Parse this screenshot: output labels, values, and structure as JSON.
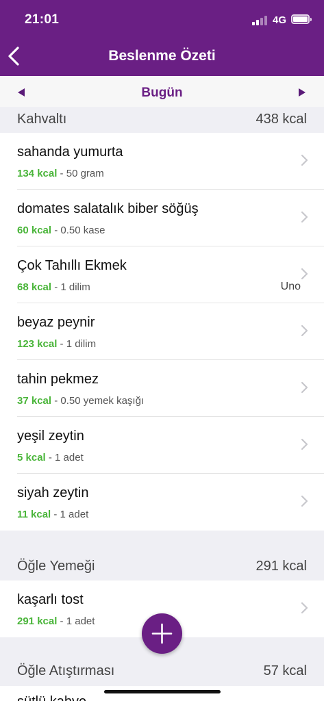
{
  "status": {
    "time": "21:01",
    "network": "4G"
  },
  "nav": {
    "title": "Beslenme Özeti"
  },
  "date": {
    "label": "Bugün"
  },
  "sections": [
    {
      "name": "Kahvaltı",
      "kcal": "438 kcal",
      "items": [
        {
          "name": "sahanda yumurta",
          "kcal": "134 kcal",
          "amount": " - 50 gram"
        },
        {
          "name": "domates salatalık biber söğüş",
          "kcal": "60 kcal",
          "amount": " - 0.50 kase"
        },
        {
          "name": "Çok Tahıllı Ekmek",
          "kcal": "68 kcal",
          "amount": " - 1 dilim",
          "brand": "Uno"
        },
        {
          "name": "beyaz peynir",
          "kcal": "123 kcal",
          "amount": " - 1 dilim"
        },
        {
          "name": "tahin pekmez",
          "kcal": "37 kcal",
          "amount": " - 0.50 yemek kaşığı"
        },
        {
          "name": "yeşil zeytin",
          "kcal": "5 kcal",
          "amount": " - 1 adet"
        },
        {
          "name": "siyah zeytin",
          "kcal": "11 kcal",
          "amount": " - 1 adet"
        }
      ]
    },
    {
      "name": "Öğle Yemeği",
      "kcal": "291 kcal",
      "items": [
        {
          "name": "kaşarlı tost",
          "kcal": "291 kcal",
          "amount": " - 1 adet"
        }
      ]
    },
    {
      "name": "Öğle Atıştırması",
      "kcal": "57 kcal",
      "items": [
        {
          "name": "sütlü kahve"
        }
      ]
    }
  ],
  "colors": {
    "brand": "#6a1f84",
    "calorie": "#4ab53a"
  }
}
